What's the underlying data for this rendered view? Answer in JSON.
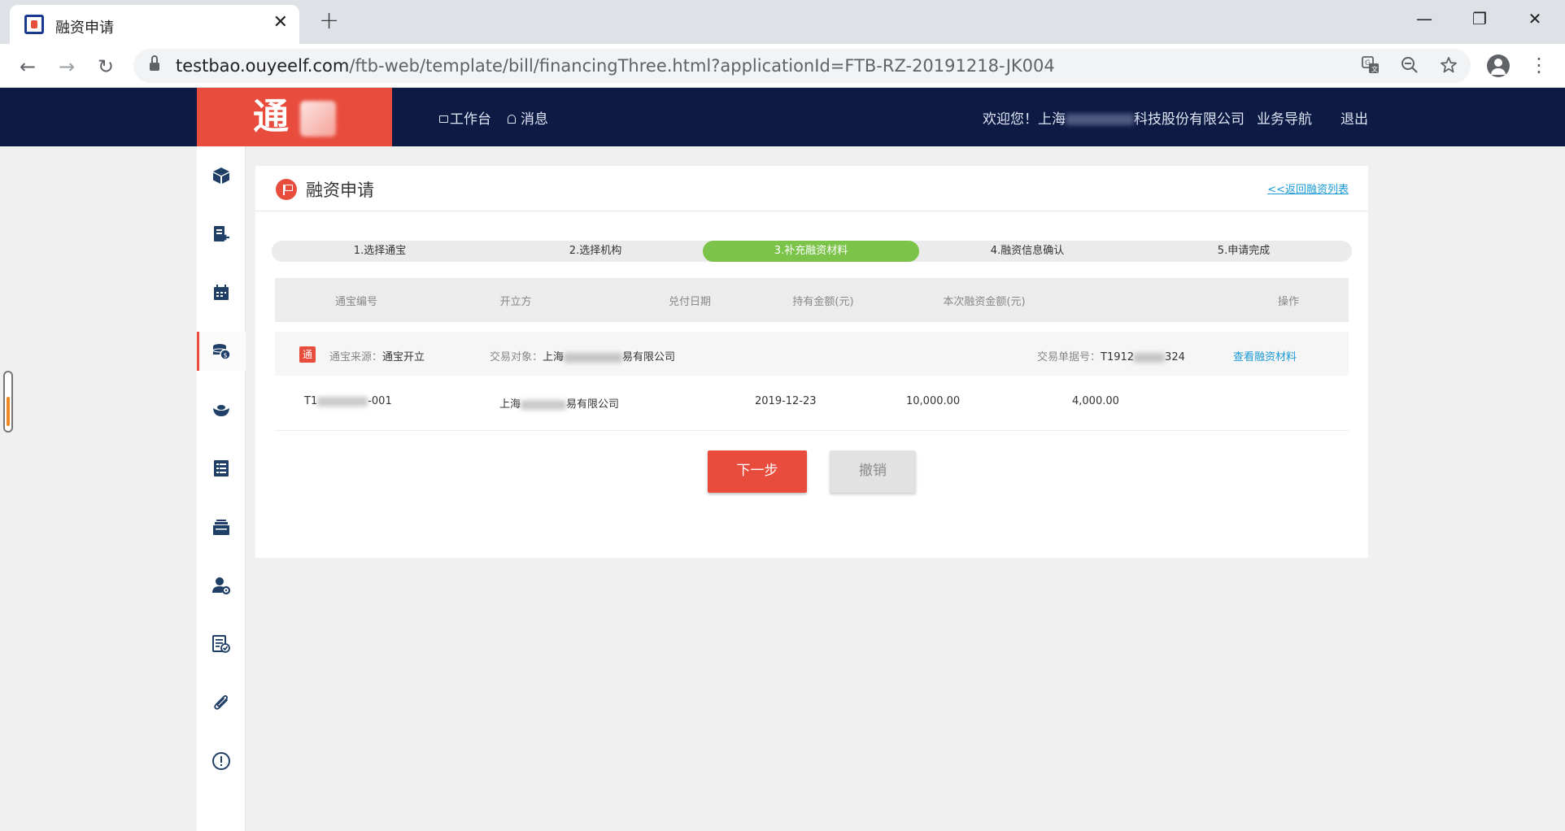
{
  "browser": {
    "tab_title": "融资申请",
    "tab_close": "✕",
    "new_tab": "+",
    "url_host": "testbao.ouyeelf.com",
    "url_path": "/ftb-web/template/bill/financingThree.html?applicationId=FTB-RZ-20191218-JK004",
    "window_controls": {
      "minimize": "—",
      "restore": "❐",
      "close": "✕"
    },
    "nav": {
      "back": "←",
      "forward": "→",
      "reload": "↻"
    },
    "omnibox_icons": [
      "translate-icon",
      "zoom-out-icon",
      "star-icon"
    ],
    "menu": "⋮"
  },
  "header": {
    "logo_char": "通",
    "nav_workbench": "工作台",
    "nav_messages": "消息",
    "welcome_prefix": "欢迎您！上海",
    "welcome_suffix": "科技股份有限公司",
    "business_nav": "业务导航",
    "logout": "退出"
  },
  "sidebar": {
    "items": [
      "cube-icon",
      "document-return-icon",
      "calendar-icon",
      "coins-icon",
      "ingot-icon",
      "ledger-icon",
      "stack-icon",
      "user-settings-icon",
      "checklist-icon",
      "paperclip-icon",
      "alert-icon"
    ],
    "active_index": 3
  },
  "page": {
    "title": "融资申请",
    "back_link": "<<返回融资列表",
    "steps": [
      "1.选择通宝",
      "2.选择机构",
      "3.补充融资材料",
      "4.融资信息确认",
      "5.申请完成"
    ],
    "active_step": 2
  },
  "table": {
    "headers": [
      "通宝编号",
      "开立方",
      "兑付日期",
      "持有金额(元)",
      "本次融资金额(元)",
      "操作"
    ],
    "group": {
      "badge": "通",
      "source_label": "通宝来源：",
      "source_value": "通宝开立",
      "counterparty_label": "交易对象：",
      "counterparty_prefix": "上海",
      "counterparty_suffix": "易有限公司",
      "doc_label": "交易单据号：",
      "doc_prefix": "T1912",
      "doc_suffix": "324",
      "view_link": "查看融资材料"
    },
    "row": {
      "code_prefix": "T1",
      "code_suffix": "-001",
      "issuer_prefix": "上海",
      "issuer_suffix": "易有限公司",
      "date": "2019-12-23",
      "held_amount": "10,000.00",
      "finance_amount": "4,000.00"
    }
  },
  "buttons": {
    "next": "下一步",
    "cancel": "撤销"
  },
  "colors": {
    "brand_red": "#e84c3d",
    "header_navy": "#0d1a44",
    "step_active_green": "#7cc34a",
    "link_blue": "#1a9ad6"
  }
}
